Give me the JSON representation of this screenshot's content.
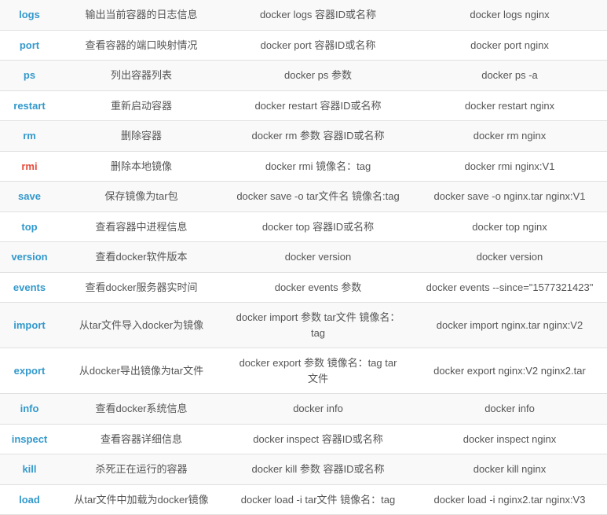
{
  "rows": [
    {
      "cmd": "logs",
      "desc": "输出当前容器的日志信息",
      "syntax": "docker logs 容器ID或名称",
      "example": "docker logs nginx",
      "redCmd": false
    },
    {
      "cmd": "port",
      "desc": "查看容器的端口映射情况",
      "syntax": "docker port 容器ID或名称",
      "example": "docker port nginx",
      "redCmd": false
    },
    {
      "cmd": "ps",
      "desc": "列出容器列表",
      "syntax": "docker ps 参数",
      "example": "docker ps -a",
      "redCmd": false
    },
    {
      "cmd": "restart",
      "desc": "重新启动容器",
      "syntax": "docker restart 容器ID或名称",
      "example": "docker restart nginx",
      "redCmd": false
    },
    {
      "cmd": "rm",
      "desc": "删除容器",
      "syntax": "docker rm 参数 容器ID或名称",
      "example": "docker rm nginx",
      "redCmd": false
    },
    {
      "cmd": "rmi",
      "desc": "删除本地镜像",
      "syntax": "docker rmi 镜像名：tag",
      "example": "docker rmi nginx:V1",
      "redCmd": true
    },
    {
      "cmd": "save",
      "desc": "保存镜像为tar包",
      "syntax": "docker save -o tar文件名 镜像名:tag",
      "example": "docker save -o nginx.tar nginx:V1",
      "redCmd": false
    },
    {
      "cmd": "top",
      "desc": "查看容器中进程信息",
      "syntax": "docker top 容器ID或名称",
      "example": "docker top nginx",
      "redCmd": false
    },
    {
      "cmd": "version",
      "desc": "查看docker软件版本",
      "syntax": "docker version",
      "example": "docker version",
      "redCmd": false
    },
    {
      "cmd": "events",
      "desc": "查看docker服务器实时间",
      "syntax": "docker events 参数",
      "example": "docker events --since=\"1577321423\"",
      "redCmd": false
    },
    {
      "cmd": "import",
      "desc": "从tar文件导入docker为镜像",
      "syntax": "docker import 参数 tar文件 镜像名：tag",
      "example": "docker import nginx.tar nginx:V2",
      "redCmd": false
    },
    {
      "cmd": "export",
      "desc": "从docker导出镜像为tar文件",
      "syntax": "docker export 参数 镜像名：tag tar文件",
      "example": "docker export nginx:V2 nginx2.tar",
      "redCmd": false
    },
    {
      "cmd": "info",
      "desc": "查看docker系统信息",
      "syntax": "docker info",
      "example": "docker info",
      "redCmd": false
    },
    {
      "cmd": "inspect",
      "desc": "查看容器详细信息",
      "syntax": "docker inspect 容器ID或名称",
      "example": "docker inspect nginx",
      "redCmd": false
    },
    {
      "cmd": "kill",
      "desc": "杀死正在运行的容器",
      "syntax": "docker kill 参数 容器ID或名称",
      "example": "docker kill nginx",
      "redCmd": false
    },
    {
      "cmd": "load",
      "desc": "从tar文件中加载为docker镜像",
      "syntax": "docker load -i tar文件 镜像名：tag",
      "example": "docker load -i nginx2.tar nginx:V3",
      "redCmd": false
    }
  ]
}
